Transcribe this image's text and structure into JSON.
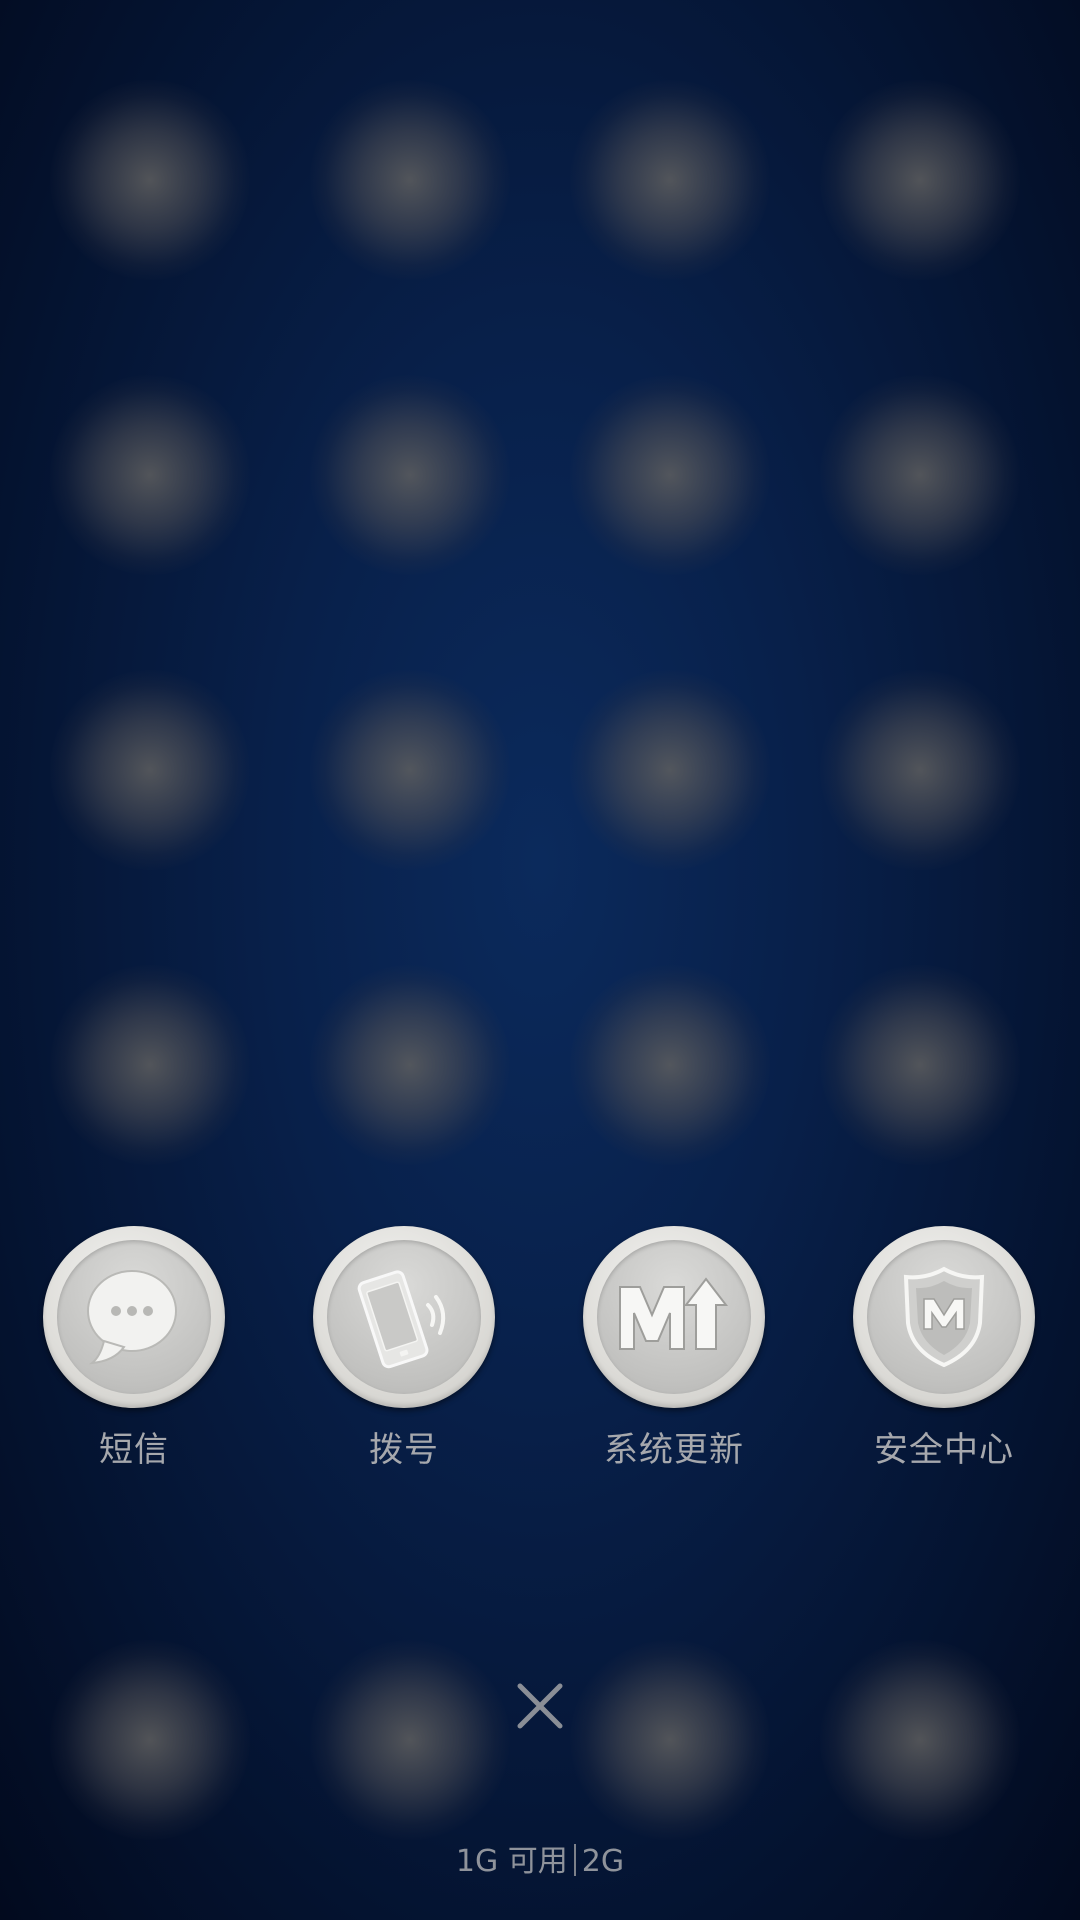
{
  "dock_apps": [
    {
      "label": "短信",
      "icon": "message-bubble-icon"
    },
    {
      "label": "拨号",
      "icon": "phone-dial-icon"
    },
    {
      "label": "系统更新",
      "icon": "system-update-icon"
    },
    {
      "label": "安全中心",
      "icon": "security-shield-icon"
    }
  ],
  "close_button": {
    "icon": "close-icon"
  },
  "memory": {
    "available": "1G 可用",
    "total": "2G"
  },
  "colors": {
    "background": "#08204a",
    "label": "#a6a8ad",
    "icon_plate": "#dddcd8"
  }
}
